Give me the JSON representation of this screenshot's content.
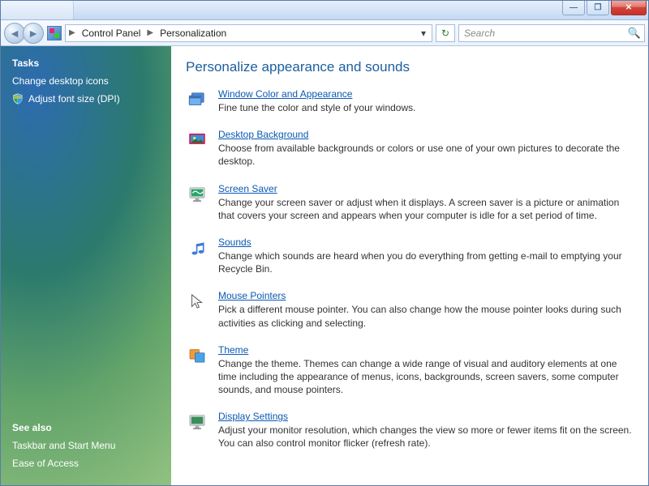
{
  "window": {
    "min_glyph": "—",
    "max_glyph": "❐",
    "close_glyph": "✕"
  },
  "breadcrumb": {
    "items": [
      "Control Panel",
      "Personalization"
    ]
  },
  "search": {
    "placeholder": "Search"
  },
  "sidebar": {
    "tasks_title": "Tasks",
    "tasks": [
      {
        "label": "Change desktop icons",
        "shield": false
      },
      {
        "label": "Adjust font size (DPI)",
        "shield": true
      }
    ],
    "see_also_title": "See also",
    "see_also": [
      {
        "label": "Taskbar and Start Menu"
      },
      {
        "label": "Ease of Access"
      }
    ]
  },
  "page": {
    "title": "Personalize appearance and sounds",
    "items": [
      {
        "id": "window-color",
        "title": "Window Color and Appearance",
        "desc": "Fine tune the color and style of your windows."
      },
      {
        "id": "desktop-background",
        "title": "Desktop Background",
        "desc": "Choose from available backgrounds or colors or use one of your own pictures to decorate the desktop."
      },
      {
        "id": "screen-saver",
        "title": "Screen Saver",
        "desc": "Change your screen saver or adjust when it displays. A screen saver is a picture or animation that covers your screen and appears when your computer is idle for a set period of time."
      },
      {
        "id": "sounds",
        "title": "Sounds",
        "desc": "Change which sounds are heard when you do everything from getting e-mail to emptying your Recycle Bin."
      },
      {
        "id": "mouse-pointers",
        "title": "Mouse Pointers",
        "desc": "Pick a different mouse pointer. You can also change how the mouse pointer looks during such activities as clicking and selecting."
      },
      {
        "id": "theme",
        "title": "Theme",
        "desc": "Change the theme. Themes can change a wide range of visual and auditory elements at one time including the appearance of menus, icons, backgrounds, screen savers, some computer sounds, and mouse pointers."
      },
      {
        "id": "display-settings",
        "title": "Display Settings",
        "desc": "Adjust your monitor resolution, which changes the view so more or fewer items fit on the screen. You can also control monitor flicker (refresh rate)."
      }
    ]
  }
}
